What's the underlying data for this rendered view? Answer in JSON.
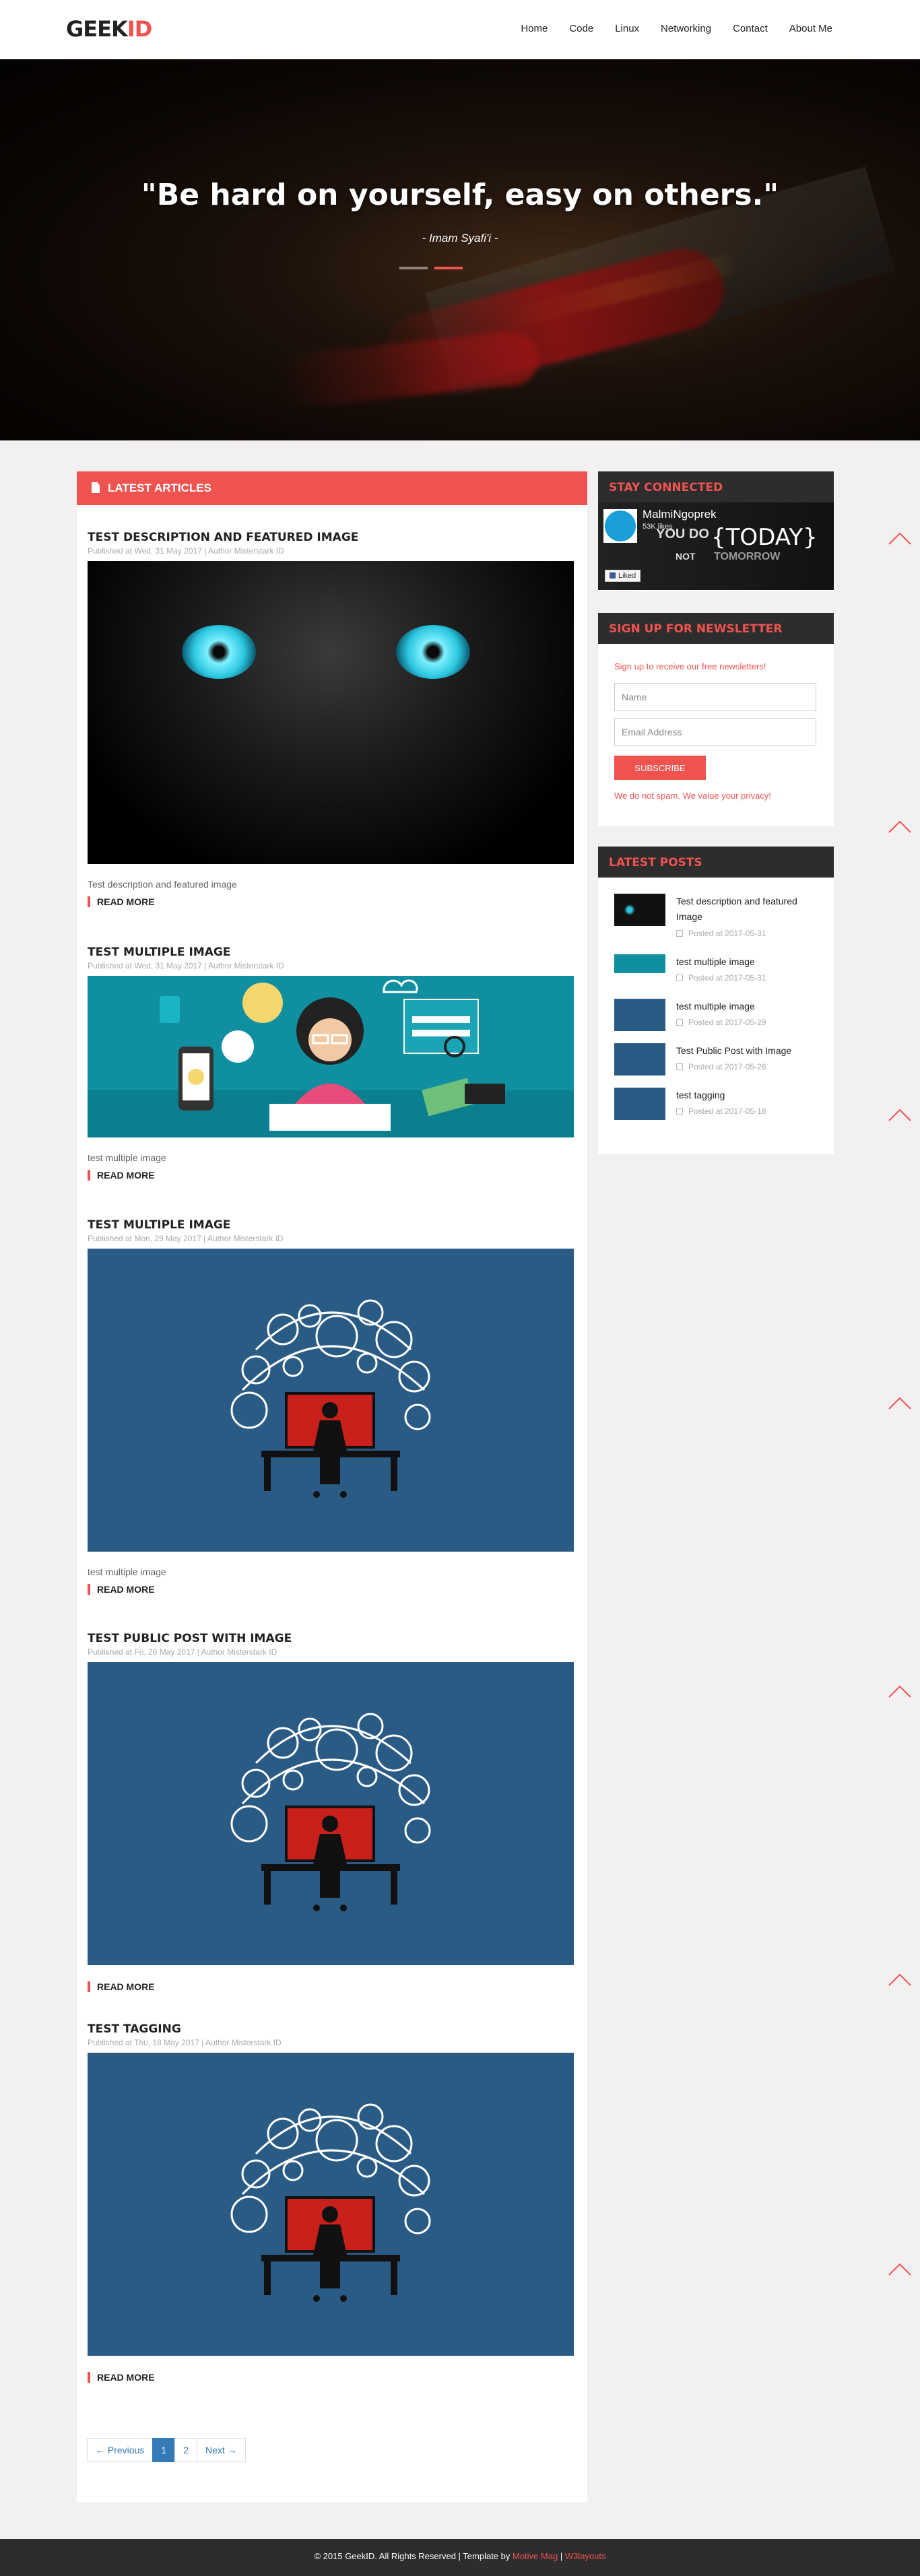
{
  "header": {
    "logo_main": "GEEK",
    "logo_accent": "ID",
    "nav": [
      "Home",
      "Code",
      "Linux",
      "Networking",
      "Contact",
      "About Me"
    ]
  },
  "hero": {
    "quote": "\"Be hard on yourself, easy on others.\"",
    "author": "- Imam Syafi'i -",
    "slides": 2,
    "active_slide": 2
  },
  "main": {
    "section_title": "LATEST ARTICLES",
    "read_more": "READ MORE",
    "posts": [
      {
        "title": "TEST DESCRIPTION AND FEATURED IMAGE",
        "meta": "Published at Wed, 31 May 2017 | Author Misterstark ID",
        "desc": "Test description and featured image"
      },
      {
        "title": "TEST MULTIPLE IMAGE",
        "meta": "Published at Wed, 31 May 2017 | Author Misterstark ID",
        "desc": "test multiple image"
      },
      {
        "title": "TEST MULTIPLE IMAGE",
        "meta": "Published at Mon, 29 May 2017 | Author Misterstark ID",
        "desc": "test multiple image"
      },
      {
        "title": "TEST PUBLIC POST WITH IMAGE",
        "meta": "Published at Fri, 26 May 2017 | Author Misterstark ID",
        "desc": ""
      },
      {
        "title": "TEST TAGGING",
        "meta": "Published at Thu, 18 May 2017 | Author Misterstark ID",
        "desc": ""
      }
    ],
    "pagination": {
      "prev": "← Previous",
      "pages": [
        "1",
        "2"
      ],
      "active": "1",
      "next": "Next →"
    }
  },
  "sidebar": {
    "stay_connected": {
      "title": "STAY CONNECTED",
      "page_name": "MalmiNgoprek",
      "likes": "53K likes",
      "cover_text_1": "YOU DO",
      "cover_text_2": "TODAY",
      "cover_text_3": "NOT",
      "cover_text_4": "TOMORROW",
      "liked": "Liked"
    },
    "newsletter": {
      "title": "SIGN UP FOR NEWSLETTER",
      "intro": "Sign up to receive our free newsletters!",
      "name_placeholder": "Name",
      "email_placeholder": "Email Address",
      "button": "SUBSCRIBE",
      "note": "We do not spam. We value your privacy!"
    },
    "latest_posts": {
      "title": "LATEST POSTS",
      "items": [
        {
          "title": "Test description and featured Image",
          "date": "Posted at 2017-05-31"
        },
        {
          "title": "test multiple image",
          "date": "Posted at 2017-05-31"
        },
        {
          "title": "test multiple image",
          "date": "Posted at 2017-05-29"
        },
        {
          "title": "Test Public Post with Image",
          "date": "Posted at 2017-05-26"
        },
        {
          "title": "test tagging",
          "date": "Posted at 2017-05-18"
        }
      ]
    }
  },
  "footer": {
    "copyright": "© 2015 GeekID. All Rights Reserved | Template by ",
    "template_by": "Motive Mag",
    "separator": " | ",
    "layouts": "W3layouts"
  }
}
